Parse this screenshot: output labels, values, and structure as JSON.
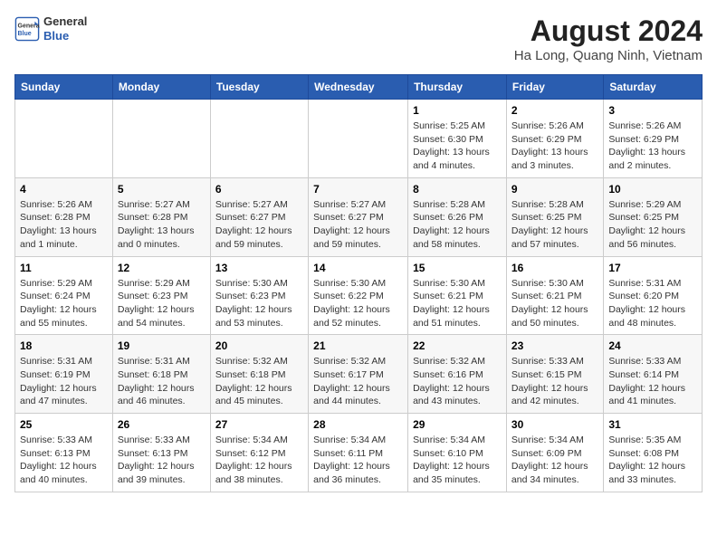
{
  "logo": {
    "general": "General",
    "blue": "Blue"
  },
  "title": "August 2024",
  "location": "Ha Long, Quang Ninh, Vietnam",
  "days_header": [
    "Sunday",
    "Monday",
    "Tuesday",
    "Wednesday",
    "Thursday",
    "Friday",
    "Saturday"
  ],
  "weeks": [
    [
      {
        "day": "",
        "detail": ""
      },
      {
        "day": "",
        "detail": ""
      },
      {
        "day": "",
        "detail": ""
      },
      {
        "day": "",
        "detail": ""
      },
      {
        "day": "1",
        "detail": "Sunrise: 5:25 AM\nSunset: 6:30 PM\nDaylight: 13 hours\nand 4 minutes."
      },
      {
        "day": "2",
        "detail": "Sunrise: 5:26 AM\nSunset: 6:29 PM\nDaylight: 13 hours\nand 3 minutes."
      },
      {
        "day": "3",
        "detail": "Sunrise: 5:26 AM\nSunset: 6:29 PM\nDaylight: 13 hours\nand 2 minutes."
      }
    ],
    [
      {
        "day": "4",
        "detail": "Sunrise: 5:26 AM\nSunset: 6:28 PM\nDaylight: 13 hours\nand 1 minute."
      },
      {
        "day": "5",
        "detail": "Sunrise: 5:27 AM\nSunset: 6:28 PM\nDaylight: 13 hours\nand 0 minutes."
      },
      {
        "day": "6",
        "detail": "Sunrise: 5:27 AM\nSunset: 6:27 PM\nDaylight: 12 hours\nand 59 minutes."
      },
      {
        "day": "7",
        "detail": "Sunrise: 5:27 AM\nSunset: 6:27 PM\nDaylight: 12 hours\nand 59 minutes."
      },
      {
        "day": "8",
        "detail": "Sunrise: 5:28 AM\nSunset: 6:26 PM\nDaylight: 12 hours\nand 58 minutes."
      },
      {
        "day": "9",
        "detail": "Sunrise: 5:28 AM\nSunset: 6:25 PM\nDaylight: 12 hours\nand 57 minutes."
      },
      {
        "day": "10",
        "detail": "Sunrise: 5:29 AM\nSunset: 6:25 PM\nDaylight: 12 hours\nand 56 minutes."
      }
    ],
    [
      {
        "day": "11",
        "detail": "Sunrise: 5:29 AM\nSunset: 6:24 PM\nDaylight: 12 hours\nand 55 minutes."
      },
      {
        "day": "12",
        "detail": "Sunrise: 5:29 AM\nSunset: 6:23 PM\nDaylight: 12 hours\nand 54 minutes."
      },
      {
        "day": "13",
        "detail": "Sunrise: 5:30 AM\nSunset: 6:23 PM\nDaylight: 12 hours\nand 53 minutes."
      },
      {
        "day": "14",
        "detail": "Sunrise: 5:30 AM\nSunset: 6:22 PM\nDaylight: 12 hours\nand 52 minutes."
      },
      {
        "day": "15",
        "detail": "Sunrise: 5:30 AM\nSunset: 6:21 PM\nDaylight: 12 hours\nand 51 minutes."
      },
      {
        "day": "16",
        "detail": "Sunrise: 5:30 AM\nSunset: 6:21 PM\nDaylight: 12 hours\nand 50 minutes."
      },
      {
        "day": "17",
        "detail": "Sunrise: 5:31 AM\nSunset: 6:20 PM\nDaylight: 12 hours\nand 48 minutes."
      }
    ],
    [
      {
        "day": "18",
        "detail": "Sunrise: 5:31 AM\nSunset: 6:19 PM\nDaylight: 12 hours\nand 47 minutes."
      },
      {
        "day": "19",
        "detail": "Sunrise: 5:31 AM\nSunset: 6:18 PM\nDaylight: 12 hours\nand 46 minutes."
      },
      {
        "day": "20",
        "detail": "Sunrise: 5:32 AM\nSunset: 6:18 PM\nDaylight: 12 hours\nand 45 minutes."
      },
      {
        "day": "21",
        "detail": "Sunrise: 5:32 AM\nSunset: 6:17 PM\nDaylight: 12 hours\nand 44 minutes."
      },
      {
        "day": "22",
        "detail": "Sunrise: 5:32 AM\nSunset: 6:16 PM\nDaylight: 12 hours\nand 43 minutes."
      },
      {
        "day": "23",
        "detail": "Sunrise: 5:33 AM\nSunset: 6:15 PM\nDaylight: 12 hours\nand 42 minutes."
      },
      {
        "day": "24",
        "detail": "Sunrise: 5:33 AM\nSunset: 6:14 PM\nDaylight: 12 hours\nand 41 minutes."
      }
    ],
    [
      {
        "day": "25",
        "detail": "Sunrise: 5:33 AM\nSunset: 6:13 PM\nDaylight: 12 hours\nand 40 minutes."
      },
      {
        "day": "26",
        "detail": "Sunrise: 5:33 AM\nSunset: 6:13 PM\nDaylight: 12 hours\nand 39 minutes."
      },
      {
        "day": "27",
        "detail": "Sunrise: 5:34 AM\nSunset: 6:12 PM\nDaylight: 12 hours\nand 38 minutes."
      },
      {
        "day": "28",
        "detail": "Sunrise: 5:34 AM\nSunset: 6:11 PM\nDaylight: 12 hours\nand 36 minutes."
      },
      {
        "day": "29",
        "detail": "Sunrise: 5:34 AM\nSunset: 6:10 PM\nDaylight: 12 hours\nand 35 minutes."
      },
      {
        "day": "30",
        "detail": "Sunrise: 5:34 AM\nSunset: 6:09 PM\nDaylight: 12 hours\nand 34 minutes."
      },
      {
        "day": "31",
        "detail": "Sunrise: 5:35 AM\nSunset: 6:08 PM\nDaylight: 12 hours\nand 33 minutes."
      }
    ]
  ]
}
